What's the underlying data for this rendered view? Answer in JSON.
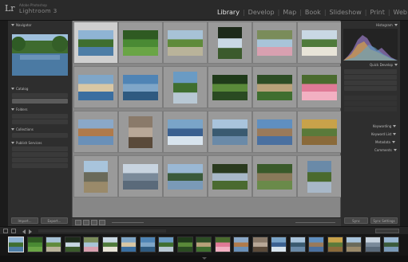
{
  "app": {
    "logo": "Lr",
    "brand_small": "Adobe Photoshop",
    "brand": "Lightroom 3"
  },
  "modules": [
    {
      "label": "Library",
      "active": true
    },
    {
      "label": "Develop",
      "active": false
    },
    {
      "label": "Map",
      "active": false
    },
    {
      "label": "Book",
      "active": false
    },
    {
      "label": "Slideshow",
      "active": false
    },
    {
      "label": "Print",
      "active": false
    },
    {
      "label": "Web",
      "active": false
    }
  ],
  "left_panel": {
    "navigator": "Navigator",
    "catalog": "Catalog",
    "folders": "Folders",
    "collections": "Collections",
    "publish": "Publish Services",
    "import_button": "Import...",
    "export_button": "Export..."
  },
  "right_panel": {
    "histogram": "Histogram",
    "quick_develop": "Quick Develop",
    "keywording": "Keywording",
    "keyword_list": "Keyword List",
    "metadata": "Metadata",
    "comments": "Comments",
    "sync_button": "Sync",
    "sync_settings": "Sync Settings"
  },
  "colors": {
    "accent_text": "#e6e6e6",
    "grid_bg": "#878787",
    "panel_bg": "#2e2e2e"
  }
}
